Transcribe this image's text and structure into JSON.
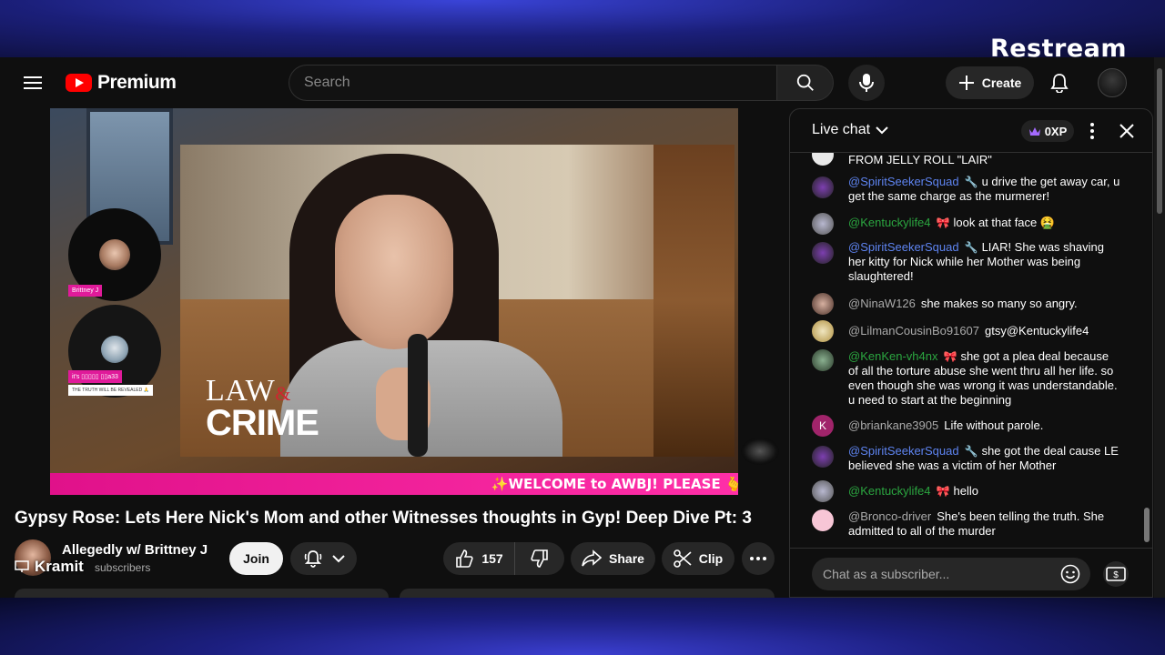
{
  "overlay": {
    "brand": "Restream"
  },
  "header": {
    "logo_text": "Premium",
    "search_placeholder": "Search",
    "create_label": "Create"
  },
  "video": {
    "ticker": "✨WELCOME to AWBJ! PLEASE 🫰 Clic",
    "pip_name_1": "Brittney J",
    "pip_name_2": "it's ▯▯▯▯▯ ▯▯a33",
    "pip_caption": "THE TRUTH WILL BE REVEALED 🙏",
    "logo_line1": "LAW",
    "logo_amp": "&",
    "logo_line2": "CRIME"
  },
  "below": {
    "title": "Gypsy Rose: Lets Here Nick's Mom and other Witnesses thoughts in Gyp! Deep Dive Pt: 3",
    "channel_name": "Allegedly w/ Brittney J",
    "subscribers": "subscribers",
    "overlay_label": "Kramit",
    "join_label": "Join",
    "like_count": "157",
    "share_label": "Share",
    "clip_label": "Clip"
  },
  "chat": {
    "title": "Live chat",
    "xp": "0XP",
    "input_placeholder": "Chat as a subscriber...",
    "messages": [
      {
        "author": "",
        "text": "FROM JELLY ROLL \"LAIR\"",
        "color": "gray"
      },
      {
        "author": "@SpiritSeekerSquad",
        "badge": "🔧",
        "text": "u drive the get away car, u get the same charge as the murmerer!",
        "color": "blue"
      },
      {
        "author": "@Kentuckylife4",
        "badge": "🎀",
        "text": "look at that face 🤮",
        "color": "green"
      },
      {
        "author": "@SpiritSeekerSquad",
        "badge": "🔧",
        "text": "LIAR! She was shaving her kitty for Nick while her Mother was being slaughtered!",
        "color": "blue"
      },
      {
        "author": "@NinaW126",
        "badge": "",
        "text": "she makes so many so angry.",
        "color": "gray"
      },
      {
        "author": "@LilmanCousinBo91607",
        "badge": "",
        "text": "gtsy@Kentuckylife4",
        "color": "gray"
      },
      {
        "author": "@KenKen-vh4nx",
        "badge": "🎀",
        "text": "she got a plea deal because of all the torture abuse she went thru all her life. so even though she was wrong it was understandable. u need to start at the beginning",
        "color": "green"
      },
      {
        "author": "@briankane3905",
        "badge": "",
        "text": "Life without parole.",
        "color": "gray"
      },
      {
        "author": "@SpiritSeekerSquad",
        "badge": "🔧",
        "text": "she got the deal cause LE believed she was a victim of her Mother",
        "color": "blue"
      },
      {
        "author": "@Kentuckylife4",
        "badge": "🎀",
        "text": "hello",
        "color": "green"
      },
      {
        "author": "@Bronco-driver",
        "badge": "",
        "text": "She's been telling the truth. She admitted to all of the murder",
        "color": "gray"
      }
    ]
  },
  "icons": {
    "menu": "hamburger-icon",
    "search": "search-icon",
    "mic": "microphone-icon",
    "bell": "bell-icon",
    "like": "thumbs-up-icon",
    "dislike": "thumbs-down-icon",
    "share": "share-arrow-icon",
    "clip": "scissors-icon",
    "more": "more-horizontal-icon",
    "close": "close-icon",
    "emoji": "emoji-icon",
    "money": "super-chat-icon"
  },
  "colors": {
    "accent_red": "#ff0000",
    "ticker_pink": "#e0118a",
    "author_blue": "#5e84f1",
    "author_green": "#2ba640"
  }
}
